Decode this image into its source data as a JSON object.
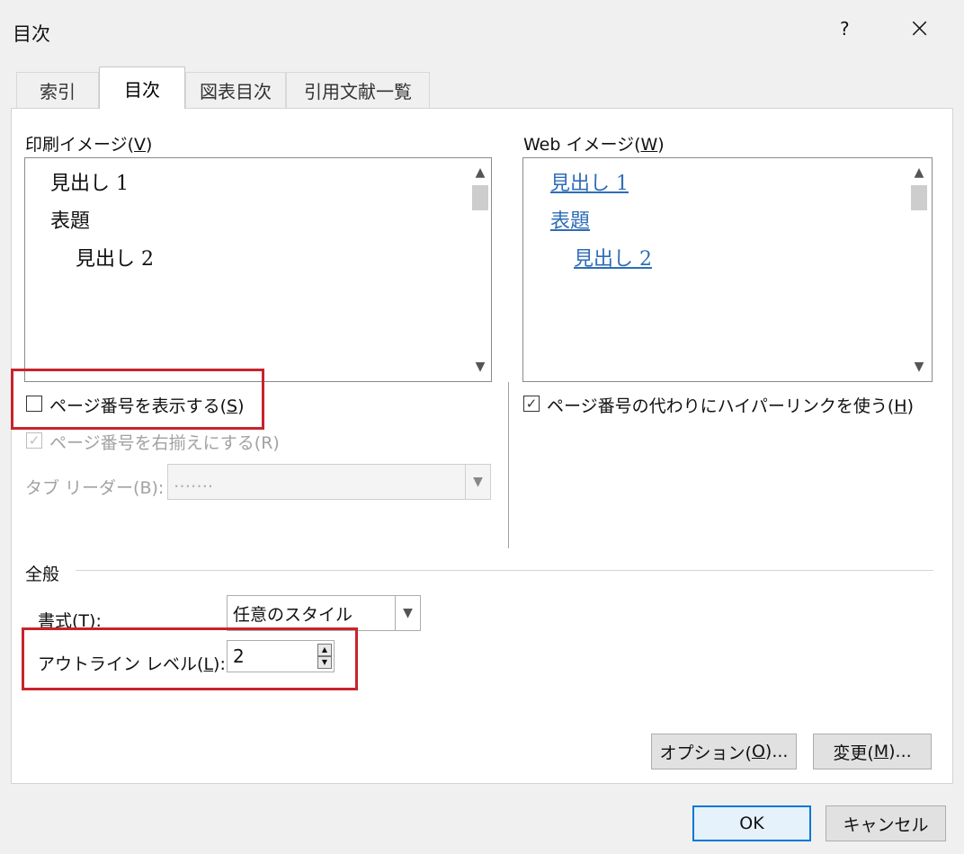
{
  "window": {
    "title": "目次",
    "help_label": "?",
    "close_label": "×"
  },
  "tabs": [
    {
      "label": "索引",
      "active": false
    },
    {
      "label": "目次",
      "active": true
    },
    {
      "label": "図表目次",
      "active": false
    },
    {
      "label": "引用文献一覧",
      "active": false
    }
  ],
  "print_preview": {
    "label": "印刷イメージ(",
    "key": "V",
    "label_end": ")",
    "items": [
      "見出し 1",
      "表題",
      "見出し 2"
    ]
  },
  "web_preview": {
    "label": "Web イメージ(",
    "key": "W",
    "label_end": ")",
    "items": [
      "見出し 1",
      "表題",
      "見出し 2"
    ]
  },
  "show_page_numbers": {
    "label": "ページ番号を表示する(",
    "key": "S",
    "label_end": ")",
    "checked": false
  },
  "right_align_page_numbers": {
    "label": "ページ番号を右揃えにする(R)",
    "checked": true,
    "disabled": true
  },
  "tab_leader": {
    "label": "タブ リーダー(B):",
    "value": "……."
  },
  "hyperlinks_instead": {
    "label": "ページ番号の代わりにハイパーリンクを使う(",
    "key": "H",
    "label_end": ")",
    "checked": true
  },
  "general": {
    "heading": "全般",
    "format_label": "書式(",
    "format_key": "T",
    "format_label_end": "):",
    "format_value": "任意のスタイル",
    "outline_label": "アウトライン レベル(",
    "outline_key": "L",
    "outline_label_end": "):",
    "outline_value": "2"
  },
  "buttons": {
    "options": "オプション(",
    "options_key": "O",
    "options_end": ")...",
    "modify": "変更(",
    "modify_key": "M",
    "modify_end": ")...",
    "ok": "OK",
    "cancel": "キャンセル"
  },
  "colors": {
    "link": "#2f6db5",
    "highlight": "#c8242c",
    "primary_border": "#0078d7"
  }
}
